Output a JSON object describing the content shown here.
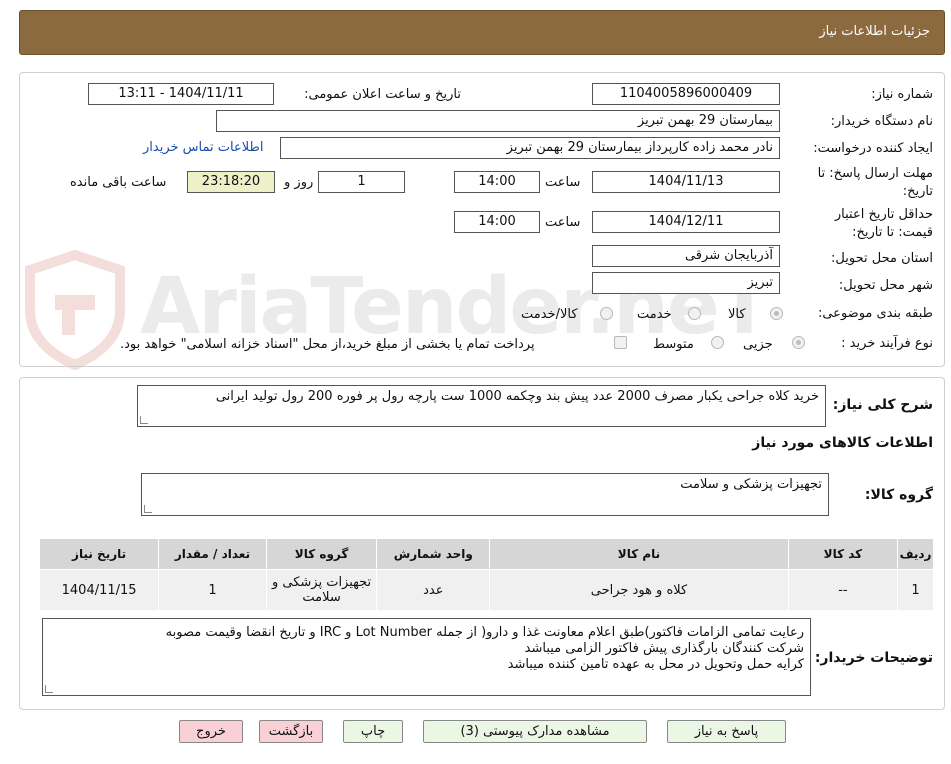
{
  "header": {
    "title": "جزئیات اطلاعات نیاز"
  },
  "info": {
    "need_number_label": "شماره نیاز:",
    "need_number": "1104005896000409",
    "announce_label": "تاریخ و ساعت اعلان عمومی:",
    "announce_value": "1404/11/11 - 13:11",
    "buyer_org_label": "نام دستگاه خریدار:",
    "buyer_org": "بیمارستان 29 بهمن تبریز",
    "creator_label": "ایجاد کننده درخواست:",
    "creator": "نادر محمد زاده کارپرداز بیمارستان 29 بهمن تبریز",
    "contact_link": "اطلاعات تماس خریدار",
    "deadline_label_1": "مهلت ارسال پاسخ: تا",
    "deadline_label_2": "تاریخ:",
    "deadline_date": "1404/11/13",
    "time_label": "ساعت",
    "deadline_time": "14:00",
    "days_value": "1",
    "days_label": "روز و",
    "remaining_time": "23:18:20",
    "remaining_label": "ساعت باقی مانده",
    "validity_label_1": "حداقل تاریخ اعتبار",
    "validity_label_2": "قیمت: تا تاریخ:",
    "validity_date": "1404/12/11",
    "validity_time_label": "ساعت",
    "validity_time": "14:00",
    "province_label": "استان محل تحویل:",
    "province": "آذربایجان شرقی",
    "city_label": "شهر محل تحویل:",
    "city": "تبریز",
    "category_label": "طبقه بندی موضوعی:",
    "category_options": [
      "کالا",
      "خدمت",
      "کالا/خدمت"
    ],
    "process_label": "نوع فرآیند خرید :",
    "process_options": [
      "جزیی",
      "متوسط"
    ],
    "payment_note": "پرداخت تمام یا بخشی از مبلغ خرید،از محل \"اسناد خزانه اسلامی\" خواهد بود."
  },
  "description": {
    "label": "شرح کلی نیاز:",
    "text": "خرید کلاه جراحی یکبار مصرف 2000 عدد پیش بند وچکمه 1000 ست  پارچه رول پر فوره 200 رول تولید ایرانی"
  },
  "goods": {
    "section_title": "اطلاعات کالاهای مورد نیاز",
    "group_label": "گروه کالا:",
    "group_value": "تجهیزات پزشکی و سلامت",
    "columns": [
      "ردیف",
      "کد کالا",
      "نام کالا",
      "واحد شمارش",
      "گروه کالا",
      "تعداد / مقدار",
      "تاریخ نیاز"
    ],
    "rows": [
      {
        "row": "1",
        "code": "--",
        "name": "کلاه و هود جراحی",
        "unit": "عدد",
        "group": "تجهیزات پزشکی و سلامت",
        "qty": "1",
        "date": "1404/11/15"
      }
    ]
  },
  "buyer_notes": {
    "label": "توضیحات خریدار:",
    "line1": "رعایت تمامی الزامات فاکتور)طبق اعلام معاونت غذا و دارو( از جمله Lot Number و IRC و تاریخ انقضا وقیمت مصوبه",
    "line2": "شرکت کنندگان بارگذاری پیش فاکتور الزامی میباشد",
    "line3": "کرایه حمل وتحویل در محل به عهده تامین کننده میباشد"
  },
  "buttons": {
    "reply": "پاسخ به نیاز",
    "attachments": "مشاهده مدارک پیوستی (3)",
    "print": "چاپ",
    "back": "بازگشت",
    "exit": "خروج"
  },
  "watermark": {
    "text": "AriaTender.neT"
  }
}
